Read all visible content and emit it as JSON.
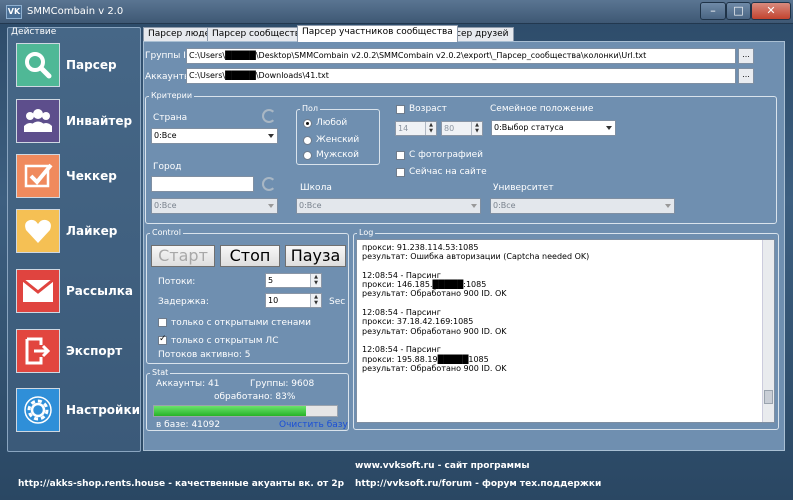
{
  "window": {
    "title": "SMMCombain v 2.0",
    "icon_text": "VK"
  },
  "sidebar": {
    "group_title": "Действие",
    "items": [
      {
        "label": "Парсер",
        "icon": "search-icon",
        "color": "#4fb896"
      },
      {
        "label": "Инвайтер",
        "icon": "users-icon",
        "color": "#5d4e8c"
      },
      {
        "label": "Чеккер",
        "icon": "check-icon",
        "color": "#f08a5d"
      },
      {
        "label": "Лайкер",
        "icon": "heart-icon",
        "color": "#f5c054"
      },
      {
        "label": "Рассылка",
        "icon": "mail-icon",
        "color": "#e0443f"
      },
      {
        "label": "Экспорт",
        "icon": "export-icon",
        "color": "#e2463f"
      },
      {
        "label": "Настройки",
        "icon": "gear-icon",
        "color": "#2f8fd8"
      }
    ]
  },
  "tabs": [
    {
      "label": "Парсер людей"
    },
    {
      "label": "Парсер сообщества"
    },
    {
      "label": "Парсер участников сообщества"
    },
    {
      "label": "Парсер друзей"
    }
  ],
  "files": {
    "groups_label": "Группы ID",
    "groups_path": "C:\\Users\\█████\\Desktop\\SMMCombain v2.0.2\\SMMCombain v2.0.2\\export\\_Парсер_сообщества\\колонки\\Url.txt",
    "accounts_label": "Аккаунты",
    "accounts_path": "C:\\Users\\█████\\Downloads\\41.txt",
    "browse": "..."
  },
  "criteria": {
    "legend": "Критерии",
    "country_label": "Страна",
    "country_value": "0:Все",
    "city_label": "Город",
    "city_value": "",
    "city_select": "0:Все",
    "sex_legend": "Пол",
    "sex_options": [
      "Любой",
      "Женский",
      "Мужской"
    ],
    "age_label": "Возраст",
    "age_from": "14",
    "age_to": "80",
    "family_label": "Семейное положение",
    "family_value": "0:Выбор статуса",
    "with_photo": "С фотографией",
    "online_now": "Сейчас на сайте",
    "school_label": "Школа",
    "school_value": "0:Все",
    "university_label": "Университет",
    "university_value": "0:Все"
  },
  "control": {
    "legend": "Control",
    "start": "Старт",
    "stop": "Стоп",
    "pause": "Пауза",
    "threads_label": "Потоки:",
    "threads_value": "5",
    "delay_label": "Задержка:",
    "delay_value": "10",
    "delay_unit": "Sec",
    "open_wall": "только с открытыми стенами",
    "open_ls": "только с открытым ЛС",
    "active_threads": "Потоков активно: 5"
  },
  "stat": {
    "legend": "Stat",
    "accounts": "Аккаунты: 41",
    "groups": "Группы: 9608",
    "processed": "обработано: 83%",
    "progress": 0.83,
    "in_base": "в базе: 41092",
    "clear": "Очистить базу"
  },
  "log": {
    "legend": "Log",
    "blocks": [
      {
        "lines": [
          "прокси: 91.238.114.53:1085",
          "результат: Ошибка авторизации (Captcha needed OK)"
        ]
      },
      {
        "lines": [
          "12:08:54 - Парсинг",
          "прокси: 146.185.█████:1085",
          "результат: Обработано 900 ID. OK"
        ]
      },
      {
        "lines": [
          "12:08:54 - Парсинг",
          "прокси: 37.18.42.169:1085",
          "результат: Обработано 900 ID. OK"
        ]
      },
      {
        "lines": [
          "12:08:54 - Парсинг",
          "прокси: 195.88.19█████1085",
          "результат: Обработано 900 ID. OK"
        ]
      }
    ]
  },
  "footer": {
    "left": "http://akks-shop.rents.house - качественные акуанты вк. от 2р",
    "right1": "www.vvksoft.ru - сайт программы",
    "right2": "http://vvksoft.ru/forum - форум тех.поддержки"
  }
}
